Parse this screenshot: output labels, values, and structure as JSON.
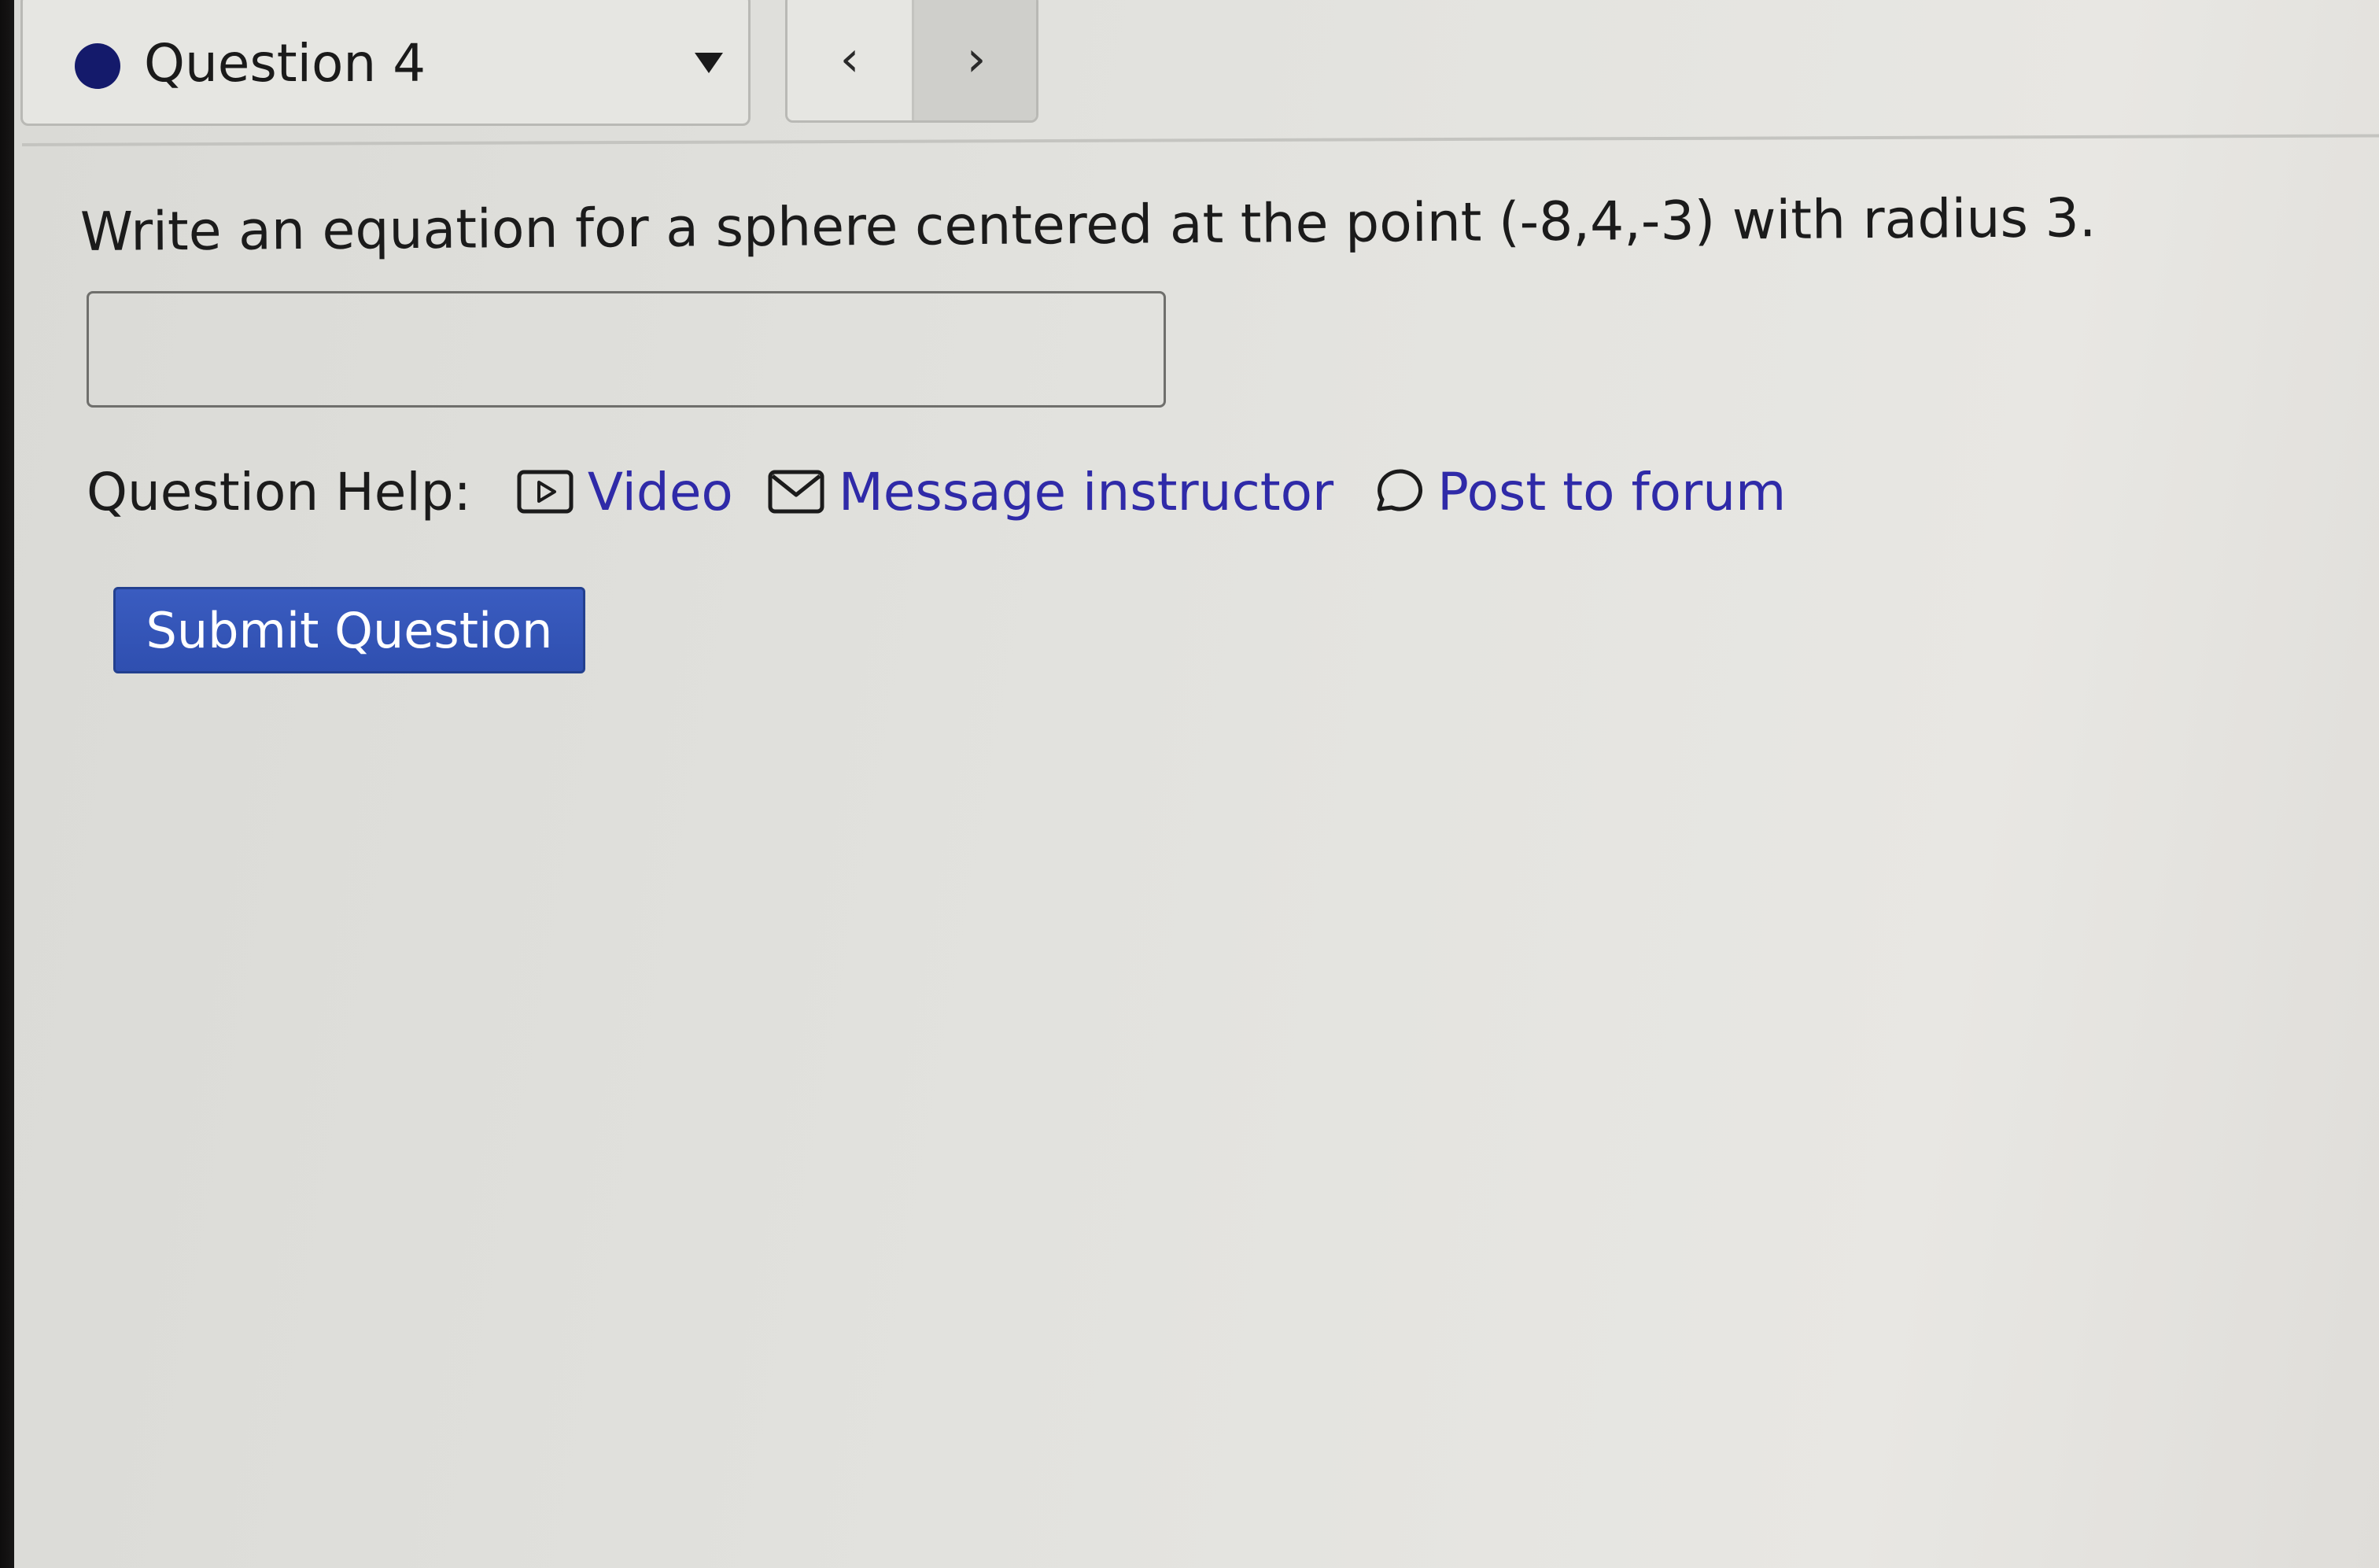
{
  "question_selector": {
    "label": "Question 4",
    "status_color": "#141a6b"
  },
  "nav": {
    "prev_glyph": "‹",
    "next_glyph": "›"
  },
  "question": {
    "prompt": "Write an equation for a sphere centered at the point (-8,4,-3) with radius 3.",
    "answer_value": ""
  },
  "help": {
    "label": "Question Help:",
    "links": [
      {
        "label": "Video",
        "icon": "video-play-icon"
      },
      {
        "label": "Message instructor",
        "icon": "envelope-icon"
      },
      {
        "label": "Post to forum",
        "icon": "speech-bubble-icon"
      }
    ],
    "link_color": "#2f2aa8"
  },
  "submit": {
    "label": "Submit Question",
    "color": "#2f4fb0"
  }
}
